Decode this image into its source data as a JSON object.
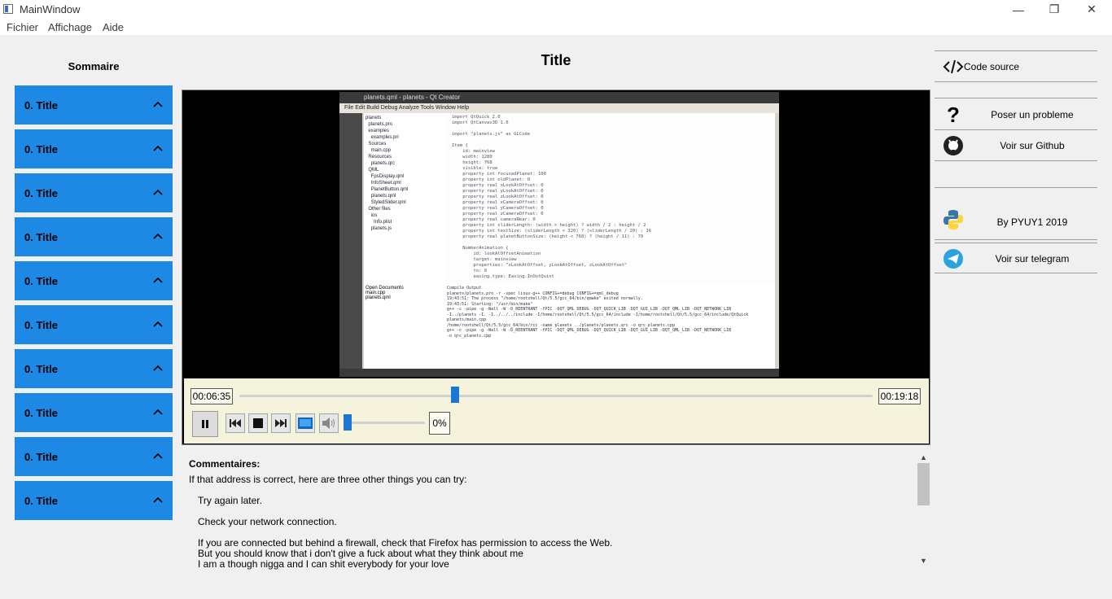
{
  "window": {
    "title": "MainWindow",
    "controls": {
      "minimize": "—",
      "maximize": "❐",
      "close": "✕"
    }
  },
  "menubar": {
    "items": [
      "Fichier",
      "Affichage",
      "Aide"
    ]
  },
  "sidebar": {
    "title": "Sommaire",
    "items": [
      {
        "label": "0. Title"
      },
      {
        "label": "0. Title"
      },
      {
        "label": "0. Title"
      },
      {
        "label": "0. Title"
      },
      {
        "label": "0. Title"
      },
      {
        "label": "0. Title"
      },
      {
        "label": "0. Title"
      },
      {
        "label": "0. Title"
      },
      {
        "label": "0. Title"
      },
      {
        "label": "0. Title"
      }
    ],
    "accent": "#1e88e5"
  },
  "main": {
    "title": "Title"
  },
  "player": {
    "current_time": "00:06:35",
    "total_time": "00:19:18",
    "seek_progress": 0.34,
    "volume": "0%",
    "volume_level": 0,
    "accent": "#1976d2",
    "video_screen": {
      "window_title": "planets.qml - planets - Qt Creator",
      "menu": "File  Edit  Build  Debug  Analyze  Tools  Window  Help",
      "tree": "planets\n  planets.pro\n  examples\n    examples.pri\n  Sources\n    main.cpp\n  Resources\n    planets.qrc\n  QML\n    FpsDisplay.qml\n    InfoSheet.qml\n    PlanetButton.qml\n    planets.qml\n    StyledSlider.qml\n  Other files\n    ios\n      Info.plist\n    planets.js",
      "code": "import QtQuick 2.0\nimport QtCanvas3D 1.0\n\nimport \"planets.js\" as GLCode\n\nItem {\n    id: mainview\n    width: 1280\n    height: 768\n    visible: true\n    property int focusedPlanet: 100\n    property int oldPlanet: 0\n    property real xLookAtOffset: 0\n    property real yLookAtOffset: 0\n    property real zLookAtOffset: 0\n    property real xCameraOffset: 0\n    property real yCameraOffset: 0\n    property real zCameraOffset: 0\n    property real cameraNear: 0\n    property int sliderLength: (width < height) ? width / 2 : height / 2\n    property int textSize: (sliderLength < 320) ? (sliderLength / 20) : 16\n    property real planetButtonSize: (height < 768) ? (height / 11) : 70\n\n    NumberAnimation {\n        id: lookAtOffsetAnimation\n        target: mainview\n        properties: \"xLookAtOffset, yLookAtOffset, zLookAtOffset\"\n        to: 0\n        easing.type: Easing.InOutQuint",
      "open_docs": "Open Documents\nmain.cpp\nplanets.qml",
      "output": "Compile Output\nplanets/planets.pro -r -spec linux-g++ CONFIG+=debug CONFIG+=qml_debug\n19:43:51: The process \"/home/rootshell/Qt/5.5/gcc_64/bin/qmake\" exited normally.\n19:43:51: Starting: \"/usr/bin/make\"\ng++ -c -pipe -g -Wall -W -D_REENTRANT -fPIC -DQT_QML_DEBUG -DQT_QUICK_LIB -DQT_GUI_LIB -DQT_QML_LIB -DQT_NETWORK_LIB\n-I../planets -I. -I../../../include -I/home/rootshell/Qt/5.5/gcc_64/include -I/home/rootshell/Qt/5.5/gcc_64/include/QtQuick\nplanets/main.cpp\n/home/rootshell/Qt/5.5/gcc_64/bin/rcc -name planets ../planets/planets.qrc -o qrc_planets.cpp\ng++ -c -pipe -g -Wall -W -D_REENTRANT -fPIC -DQT_QML_DEBUG -DQT_QUICK_LIB -DQT_GUI_LIB -DQT_QML_LIB -DQT_NETWORK_LIB\n-o qrc_planets.cpp"
    }
  },
  "comments": {
    "title": "Commentaires:",
    "intro": "If that address is correct, here are three other things you can try:",
    "lines": [
      "Try again later.",
      "Check your network connection.",
      "If you are connected but behind a firewall, check that Firefox has permission to access the Web.",
      "But you should know that i don't give a fuck about what they think about me",
      "I am a though nigga and I can shit everybody for your love"
    ]
  },
  "right_panel": {
    "code_source": "Code source",
    "poser_probleme": "Poser un probleme",
    "voir_github": "Voir sur Github",
    "by": "By PYUY1 2019",
    "telegram": "Voir sur telegram"
  }
}
